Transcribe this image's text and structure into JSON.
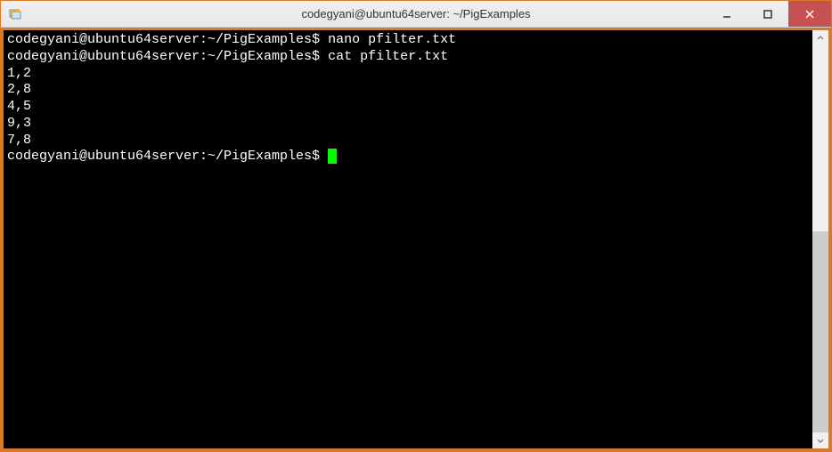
{
  "window": {
    "title": "codegyani@ubuntu64server: ~/PigExamples"
  },
  "terminal": {
    "prompt": "codegyani@ubuntu64server:~/PigExamples$",
    "lines": [
      {
        "prompt": "codegyani@ubuntu64server:~/PigExamples$",
        "command": "nano pfilter.txt"
      },
      {
        "prompt": "codegyani@ubuntu64server:~/PigExamples$",
        "command": "cat pfilter.txt"
      }
    ],
    "output": [
      "1,2",
      "2,8",
      "4,5",
      "9,3",
      "7,8"
    ],
    "current_prompt": "codegyani@ubuntu64server:~/PigExamples$"
  }
}
